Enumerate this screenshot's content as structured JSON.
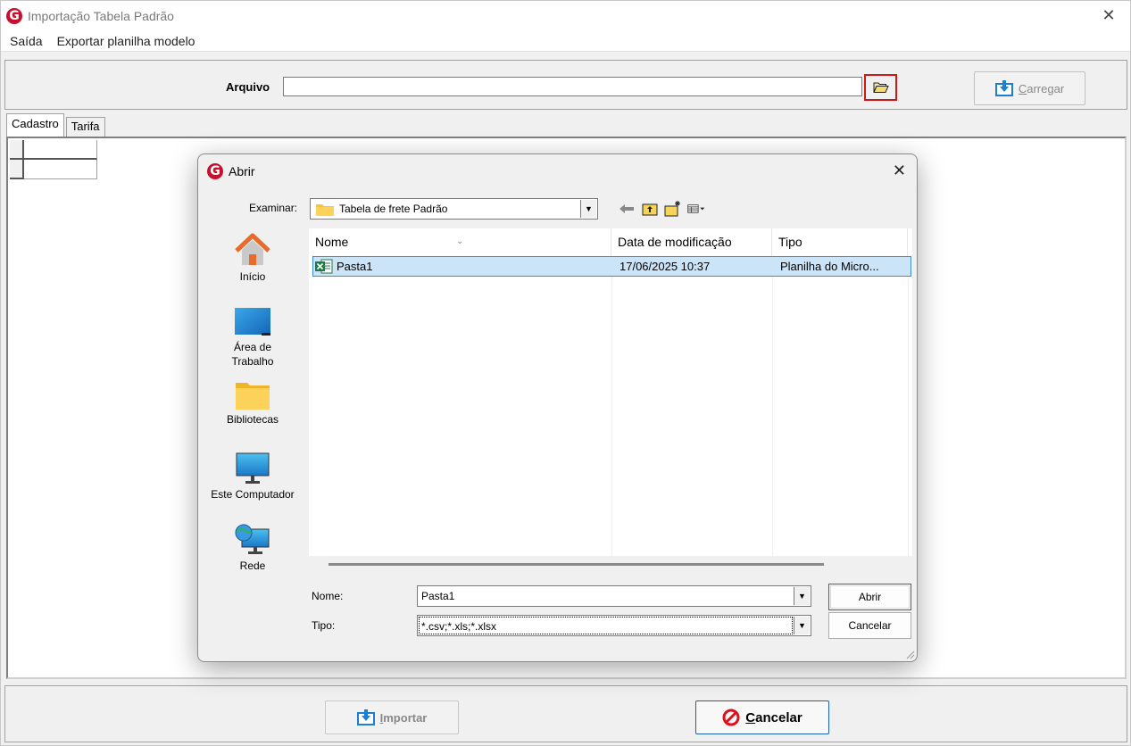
{
  "window": {
    "title": "Importação Tabela Padrão",
    "logo_letter": "G",
    "close_glyph": "✕"
  },
  "menu": {
    "items": [
      "Saída",
      "Exportar planilha modelo"
    ]
  },
  "file_panel": {
    "label": "Arquivo",
    "value": "",
    "browse_icon": "folder-open-icon",
    "load_button": {
      "underlined": "C",
      "rest": "arregar",
      "icon": "download-icon",
      "enabled": false
    }
  },
  "tabs": [
    {
      "label": "Cadastro",
      "active": true
    },
    {
      "label": "Tarifa",
      "active": false
    }
  ],
  "bottom": {
    "import_button": {
      "underlined": "I",
      "rest": "mportar",
      "enabled": false
    },
    "cancel_button": {
      "underlined": "C",
      "rest": "ancelar",
      "enabled": true
    }
  },
  "dialog": {
    "title": "Abrir",
    "logo_letter": "G",
    "close_glyph": "✕",
    "look_in_label": "Examinar:",
    "look_in_value": "Tabela de frete Padrão",
    "places": [
      {
        "label": "Início",
        "icon": "home-icon"
      },
      {
        "label": "Área de Trabalho",
        "icon": "desktop-icon"
      },
      {
        "label": "Bibliotecas",
        "icon": "libraries-folder-icon"
      },
      {
        "label": "Este Computador",
        "icon": "computer-monitor-icon"
      },
      {
        "label": "Rede",
        "icon": "network-icon"
      }
    ],
    "columns": [
      "Nome",
      "Data de modificação",
      "Tipo"
    ],
    "files": [
      {
        "name": "Pasta1",
        "modified": "17/06/2025 10:37",
        "type": "Planilha do Micro...",
        "selected": true,
        "icon": "excel-file-icon"
      }
    ],
    "name_label": "Nome:",
    "name_value": "Pasta1",
    "type_label": "Tipo:",
    "type_value": "*.csv;*.xls;*.xlsx",
    "open_button": "Abrir",
    "cancel_button": "Cancelar"
  },
  "colors": {
    "brand_red": "#c8102e",
    "selection_bg": "#cce4f7",
    "selection_border": "#3b8cd8",
    "highlight_border": "#d01818"
  }
}
